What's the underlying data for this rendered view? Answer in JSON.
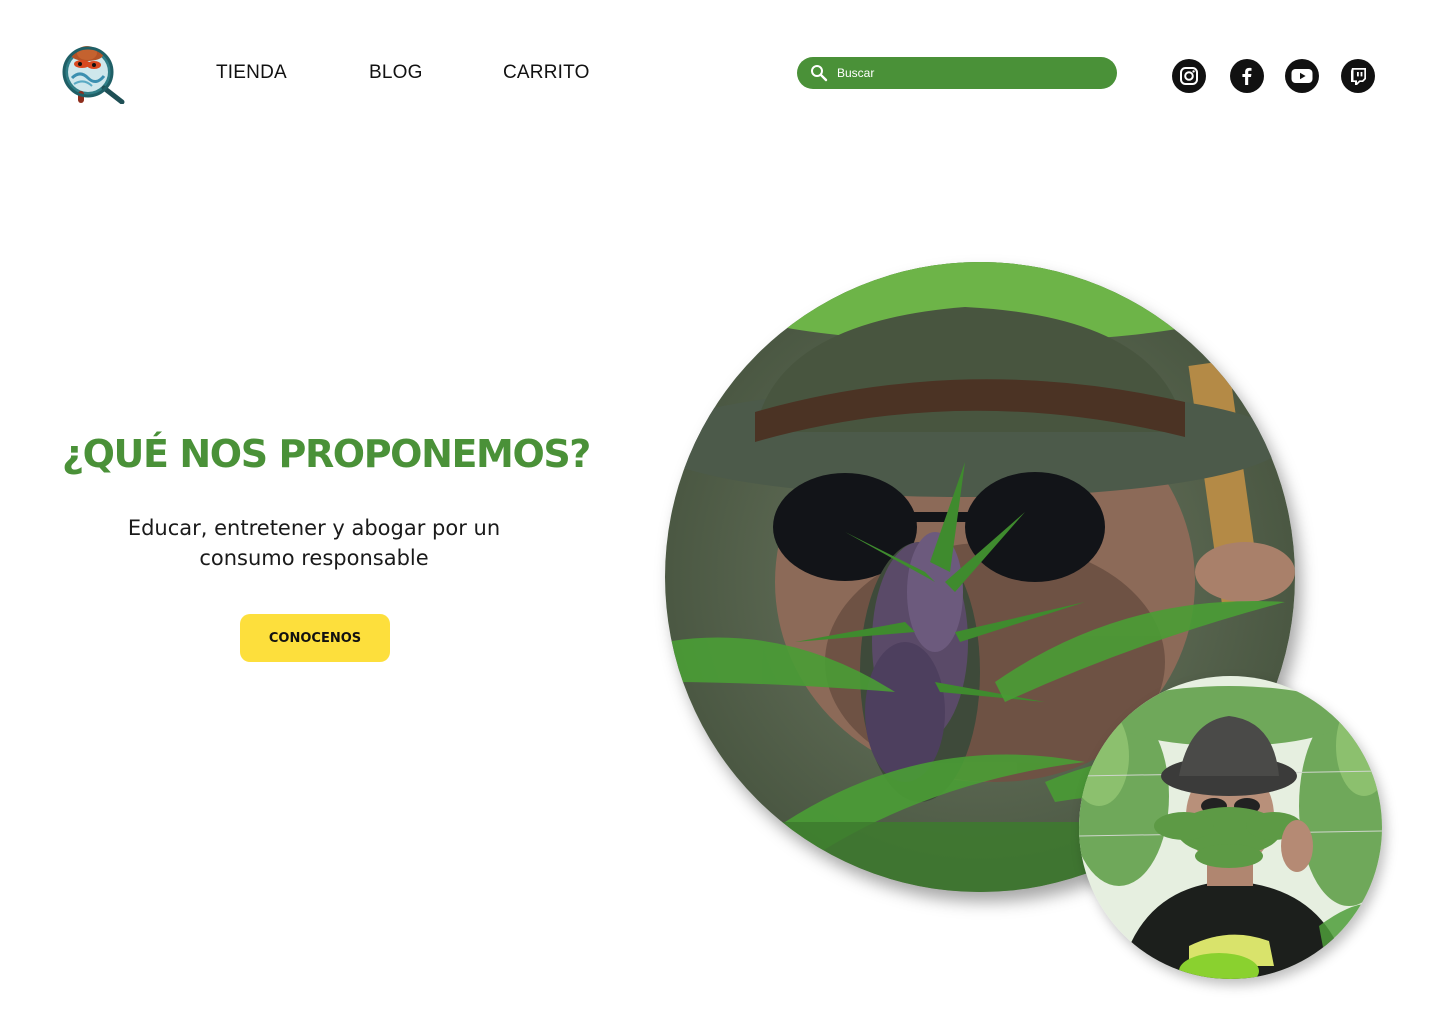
{
  "header": {
    "logo_icon": "magnifier-character-logo-icon",
    "nav": {
      "tienda": "TIENDA",
      "blog": "BLOG",
      "carrito": "CARRITO"
    },
    "search": {
      "placeholder": "Buscar",
      "icon": "search-icon"
    },
    "social": [
      {
        "icon": "instagram-icon"
      },
      {
        "icon": "facebook-icon"
      },
      {
        "icon": "youtube-icon"
      },
      {
        "icon": "twitch-icon"
      }
    ]
  },
  "hero": {
    "title": "¿QUÉ NOS PROPONEMOS?",
    "subtitle": "Educar, entretener y abogar por un consumo responsable",
    "cta_label": "CONOCENOS"
  },
  "colors": {
    "accent": "#4a9138",
    "button": "#fddf3c",
    "text": "#111111",
    "background": "#ffffff"
  }
}
